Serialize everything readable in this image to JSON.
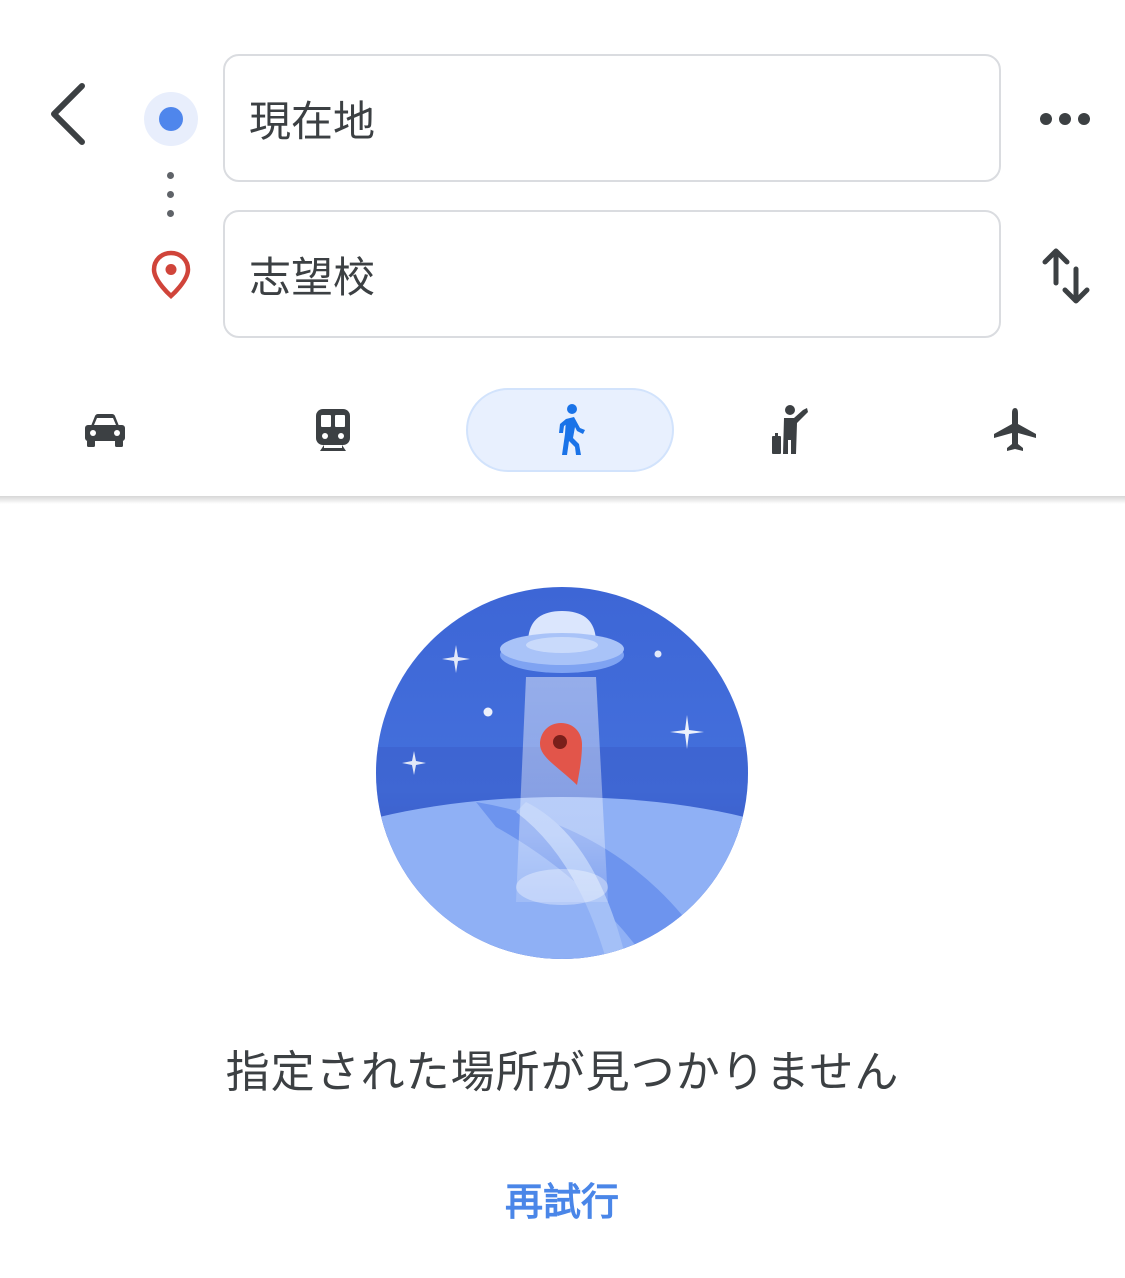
{
  "header": {
    "origin": {
      "value": "現在地",
      "icon": "current-location-dot-icon"
    },
    "destination": {
      "value": "志望校",
      "icon": "destination-pin-icon"
    },
    "back_icon": "chevron-left-icon",
    "more_icon": "more-horiz-icon",
    "swap_icon": "swap-vertical-icon"
  },
  "travel_modes": [
    {
      "id": "car",
      "icon": "car-icon",
      "selected": false
    },
    {
      "id": "transit",
      "icon": "train-icon",
      "selected": false
    },
    {
      "id": "walk",
      "icon": "walk-icon",
      "selected": true
    },
    {
      "id": "ride",
      "icon": "ride-hail-icon",
      "selected": false
    },
    {
      "id": "flight",
      "icon": "airplane-icon",
      "selected": false
    }
  ],
  "empty_state": {
    "illustration": "ufo-abducting-pin-illustration",
    "message": "指定された場所が見つかりません",
    "retry_label": "再試行"
  },
  "colors": {
    "accent": "#4a86e8",
    "selected_mode_bg": "#e8f0fe",
    "origin_dot": "#4f86ec",
    "destination_pin": "#d0443a",
    "icon_gray": "#3c4043"
  }
}
